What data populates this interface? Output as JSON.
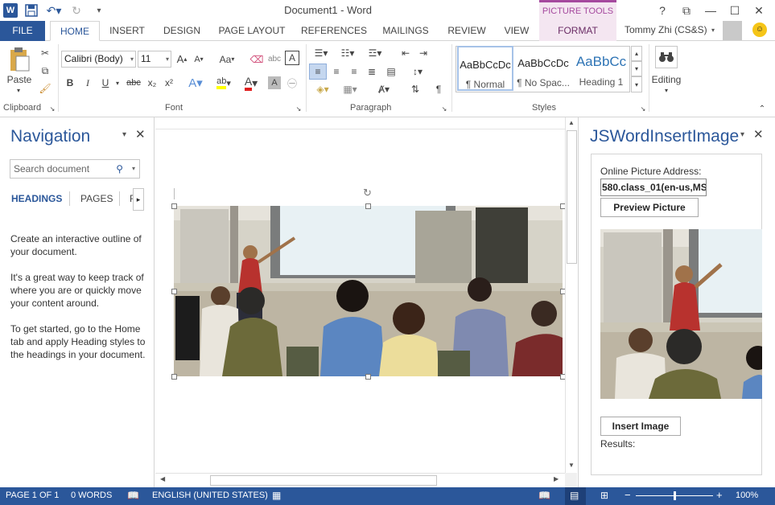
{
  "window": {
    "title": "Document1 - Word",
    "picture_tools": "PICTURE TOOLS",
    "user": "Tommy Zhi (CS&S)"
  },
  "tabs": [
    {
      "label": "FILE"
    },
    {
      "label": "HOME"
    },
    {
      "label": "INSERT"
    },
    {
      "label": "DESIGN"
    },
    {
      "label": "PAGE LAYOUT"
    },
    {
      "label": "REFERENCES"
    },
    {
      "label": "MAILINGS"
    },
    {
      "label": "REVIEW"
    },
    {
      "label": "VIEW"
    },
    {
      "label": "FORMAT"
    }
  ],
  "ribbon": {
    "clipboard": {
      "paste_label": "Paste",
      "group_label": "Clipboard"
    },
    "font": {
      "font_name": "Calibri (Body)",
      "font_size": "11",
      "aa_label": "Aa",
      "group_label": "Font",
      "bold": "B",
      "italic": "I",
      "underline": "U",
      "strike": "abc",
      "sub": "x₂",
      "sup": "x²"
    },
    "paragraph": {
      "group_label": "Paragraph"
    },
    "styles": {
      "group_label": "Styles",
      "items": [
        {
          "sample": "AaBbCcDc",
          "name": "¶ Normal"
        },
        {
          "sample": "AaBbCcDc",
          "name": "¶ No Spac..."
        },
        {
          "sample": "AaBbCc",
          "name": "Heading 1"
        }
      ]
    },
    "editing": {
      "label": "Editing"
    }
  },
  "nav": {
    "title": "Navigation",
    "search_placeholder": "Search document",
    "tabs": [
      {
        "label": "HEADINGS"
      },
      {
        "label": "PAGES"
      },
      {
        "label": "R"
      }
    ],
    "body": [
      "Create an interactive outline of your document.",
      "It's a great way to keep track of where you are or quickly move your content around.",
      "To get started, go to the Home tab and apply Heading styles to the headings in your document."
    ]
  },
  "taskpane": {
    "title": "JSWordInsertImage",
    "address_label": "Online Picture Address:",
    "address_value": "580.class_01(en-us,MS",
    "preview_button": "Preview Picture",
    "insert_button": "Insert Image",
    "results_label": "Results:"
  },
  "status": {
    "page": "PAGE 1 OF 1",
    "words": "0 WORDS",
    "language": "ENGLISH (UNITED STATES)",
    "zoom": "100%",
    "zoom_level": 1.0
  },
  "colors": {
    "accent": "#2b579a",
    "picture_tools": "#a5499e"
  }
}
